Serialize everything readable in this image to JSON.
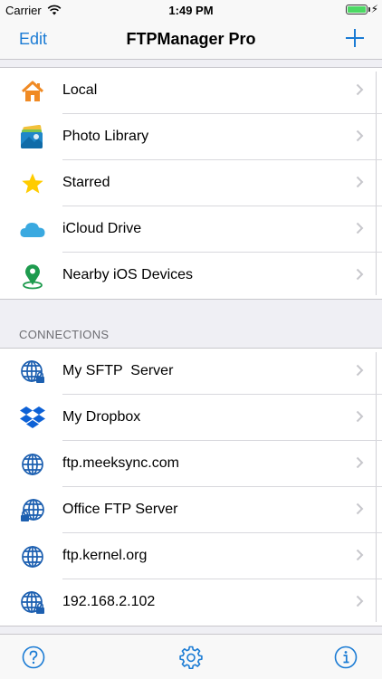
{
  "status_bar": {
    "carrier": "Carrier",
    "time": "1:49 PM"
  },
  "nav": {
    "edit_label": "Edit",
    "title": "FTPManager Pro",
    "add_icon": "plus-icon"
  },
  "locations": [
    {
      "label": "Local",
      "icon": "house-icon",
      "color": "#f08a24"
    },
    {
      "label": "Photo Library",
      "icon": "photo-library-icon",
      "color": "#2a9ad6"
    },
    {
      "label": "Starred",
      "icon": "star-icon",
      "color": "#ffcc00"
    },
    {
      "label": "iCloud Drive",
      "icon": "cloud-icon",
      "color": "#3aa9e0"
    },
    {
      "label": "Nearby iOS Devices",
      "icon": "location-pin-icon",
      "color": "#1e9b4e"
    }
  ],
  "connections_header": "CONNECTIONS",
  "connections": [
    {
      "label": "My SFTP  Server",
      "icon": "globe-lock-icon"
    },
    {
      "label": "My Dropbox",
      "icon": "dropbox-icon"
    },
    {
      "label": "ftp.meeksync.com",
      "icon": "globe-icon"
    },
    {
      "label": "Office FTP Server",
      "icon": "globe-lock-icon"
    },
    {
      "label": "ftp.kernel.org",
      "icon": "globe-icon"
    },
    {
      "label": "192.168.2.102",
      "icon": "globe-lock-icon"
    }
  ],
  "tab_bar": {
    "help_icon": "question-icon",
    "settings_icon": "gear-icon",
    "info_icon": "info-icon"
  },
  "colors": {
    "accent": "#1a7bd4",
    "globe": "#1c5fb0",
    "dropbox": "#0d61d6"
  }
}
